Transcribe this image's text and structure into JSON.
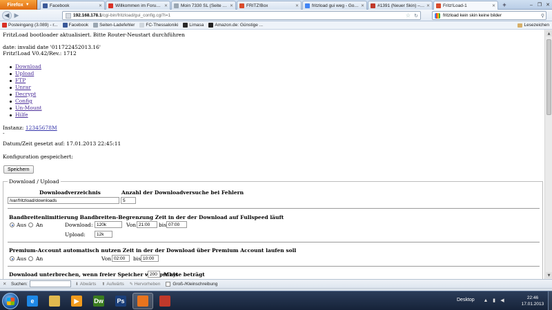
{
  "browser": {
    "app_button": "Firefox",
    "tabs": [
      {
        "label": "Facebook",
        "icon": "facebook-icon",
        "color": "#3b5998"
      },
      {
        "label": "Willkommen im Forum Fri...",
        "icon": "gmail-icon",
        "color": "#d93025"
      },
      {
        "label": "Moin 7330 SL (Seite 1) / All...",
        "icon": "page-icon",
        "color": "#9aa6b2"
      },
      {
        "label": "FRITZ!Box",
        "icon": "fritz-icon",
        "color": "#d94b2b"
      },
      {
        "label": "fritzload gui weg - Google...",
        "icon": "google-icon",
        "color": "#4285f4"
      },
      {
        "label": "#1391 (Neuer Skin) – Fritz!L...",
        "icon": "ticket-icon",
        "color": "#c0392b"
      },
      {
        "label": "Fritz!Load-1",
        "icon": "fritz-icon",
        "color": "#d94b2b",
        "active": true
      }
    ],
    "url_host": "192.168.178.1",
    "url_path": "/cgi-bin/fritzload/gui_config.cgi?i=1",
    "search_text": "fritzload kein skin keine bilder",
    "bookmarks": [
      {
        "label": "Posteingang (3.089) - r...",
        "icon": "gmail-icon",
        "color": "#d93025"
      },
      {
        "label": "Facebook",
        "icon": "facebook-icon",
        "color": "#3b5998"
      },
      {
        "label": "Seiten-Ladefehler",
        "icon": "page-icon",
        "color": "#9aa6b2"
      },
      {
        "label": "FC-Thessaloniki",
        "icon": "page-icon",
        "color": "#cfd6dd"
      },
      {
        "label": "Limasa",
        "icon": "limasa-icon",
        "color": "#2a2a2a"
      },
      {
        "label": "Amazon.de: Günstige ...",
        "icon": "amazon-icon",
        "color": "#222222"
      }
    ],
    "bookmarks_menu": "Lesezeichen"
  },
  "page": {
    "status_line": "FritzLoad bootloader aktualisiert. Bitte Router-Neustart durchführen",
    "date_line": "date: invalid date '011722452013.16'",
    "version_line": "Fritz!Load V0.42/Rev.: 1712",
    "menu": [
      "Download",
      "Upload",
      "FTP",
      "Unrar",
      "Decrypt",
      "Config",
      "Un-Mount",
      "Hilfe"
    ],
    "instance_label": "Instanz: ",
    "instance_digits": "12345678M",
    "dash": "-",
    "datetime_line": "Datum/Zeit gesetzt auf: 17.01.2013 22:45:11",
    "saved_line": "Konfiguration gespeichert:",
    "save_button": "Speichern"
  },
  "form": {
    "legend": "Download / Upload",
    "col_dir": "Downloadverzeichnis",
    "col_attempts": "Anzahl der Downloadversuche bei Fehlern",
    "dir_value": "/var/fritzload/downloads",
    "attempts_value": "5",
    "bw_title": "Bandbreitenlimitierung Bandbreiten-Begrenzung Zeit in der der Download auf Fullspeed läuft",
    "aus": "Aus",
    "an": "An",
    "download_label": "Download:",
    "download_value": "120k",
    "von": "Von",
    "bis": "bis",
    "bw_from": "21:00",
    "bw_to": "07:00",
    "upload_label": "Upload:",
    "upload_value": "12k",
    "premium_title": "Premium-Account automatisch nutzen Zeit in der der Download über Premium Account laufen soll",
    "premium_from": "02:00",
    "premium_to": "10:00",
    "interrupt_prefix": "Download unterbrechen, wenn freier Speicher weniger als",
    "interrupt_value": "200",
    "interrupt_suffix": "Mbyte beträgt"
  },
  "findbar": {
    "label": "Suchen:",
    "down": "Abwärts",
    "up": "Aufwärts",
    "highlight": "Hervorheben",
    "case": "Groß-/Kleinschreibung"
  },
  "taskbar": {
    "apps": [
      {
        "name": "ie-icon",
        "glyph": "e",
        "color": "#1e88e5"
      },
      {
        "name": "explorer-icon",
        "glyph": "",
        "color": "#e0b94f"
      },
      {
        "name": "media-player-icon",
        "glyph": "▶",
        "color": "#f29b1d"
      },
      {
        "name": "dreamweaver-icon",
        "glyph": "Dw",
        "color": "#3a7d1f"
      },
      {
        "name": "photoshop-icon",
        "glyph": "Ps",
        "color": "#1b3f7a"
      },
      {
        "name": "firefox-icon",
        "glyph": "",
        "color": "#e8741e",
        "active": true
      },
      {
        "name": "app-icon",
        "glyph": "",
        "color": "#c0392b"
      }
    ],
    "desktop": "Desktop",
    "time": "22:46",
    "date": "17.01.2013"
  }
}
